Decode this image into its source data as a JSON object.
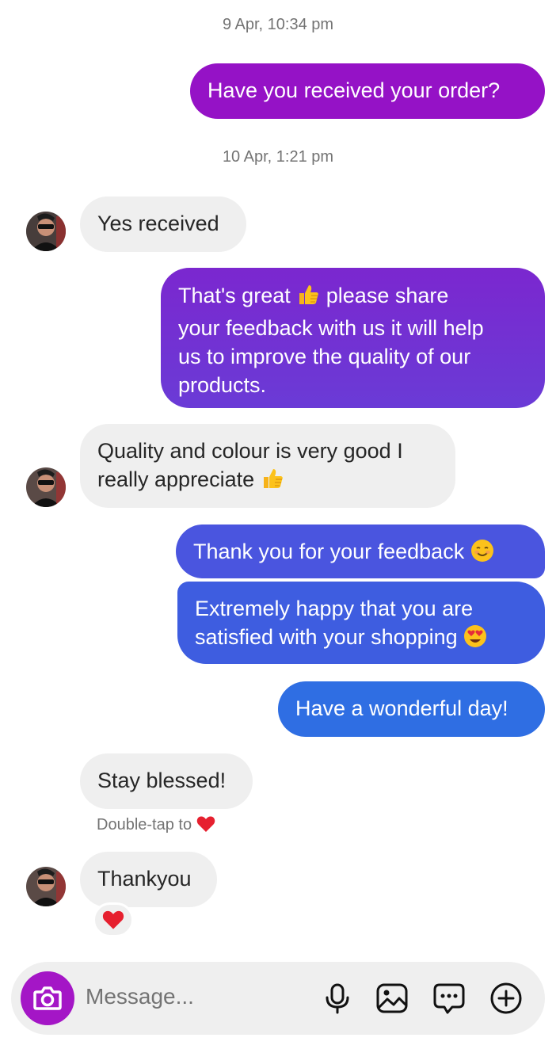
{
  "conversation": {
    "timestamps": [
      "9 Apr, 10:34 pm",
      "10 Apr, 1:21 pm"
    ],
    "messages": [
      {
        "from": "me",
        "lines": [
          "Have you received your order?"
        ]
      },
      {
        "from": "them",
        "lines": [
          "Yes received"
        ]
      },
      {
        "from": "me",
        "lines": [
          "That's great",
          "please share",
          "your feedback with us it will help",
          "us to improve the quality of our",
          "products."
        ]
      },
      {
        "from": "them",
        "lines": [
          "Quality and colour is very good I",
          "really appreciate"
        ]
      },
      {
        "from": "me",
        "lines": [
          "Thank you for your feedback"
        ]
      },
      {
        "from": "me",
        "lines": [
          "Extremely happy that you are",
          "satisfied with your shopping"
        ]
      },
      {
        "from": "me",
        "lines": [
          "Have a wonderful day!"
        ]
      },
      {
        "from": "them",
        "lines": [
          "Stay blessed!"
        ]
      },
      {
        "from": "them",
        "lines": [
          "Thankyou"
        ]
      }
    ],
    "double_tap_hint": "Double-tap to",
    "reaction": "heart-icon"
  },
  "composer": {
    "placeholder": "Message...",
    "icons": [
      "camera-icon",
      "microphone-icon",
      "gallery-icon",
      "sticker-icon",
      "add-icon"
    ]
  },
  "colors": {
    "outgoing_top": "#9b14c4",
    "outgoing_mid": "#6a3bd6",
    "outgoing_bottom": "#2f6ee3",
    "incoming": "#efefef",
    "camera_button": "#a416c6"
  }
}
